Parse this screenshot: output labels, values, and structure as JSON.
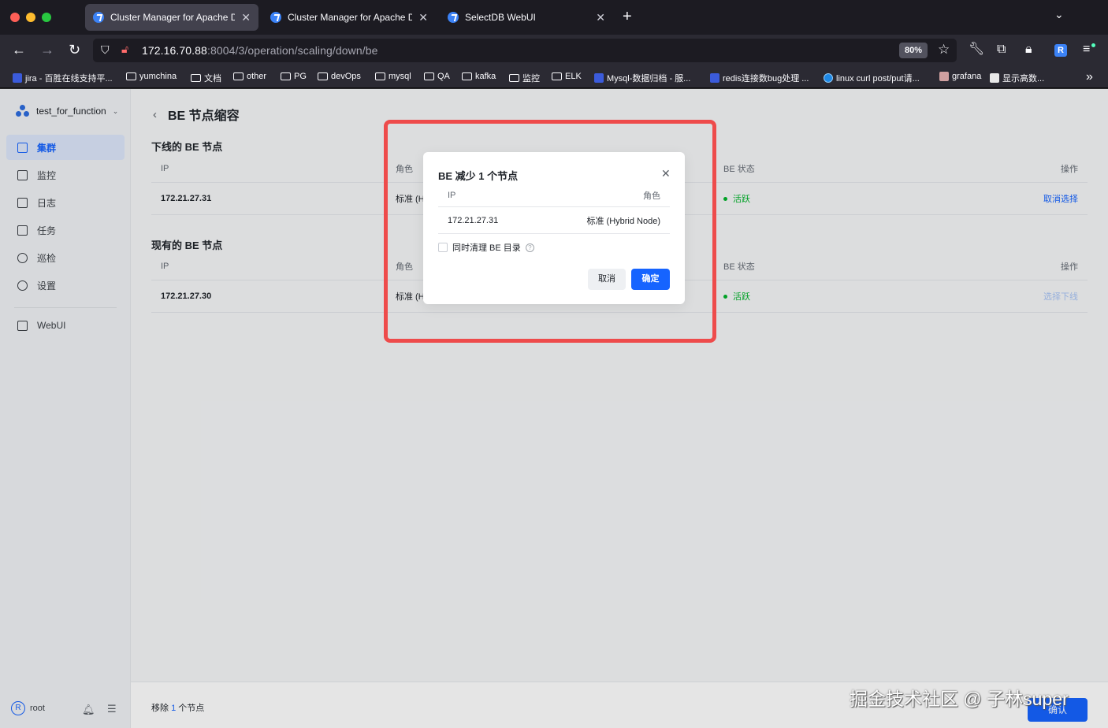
{
  "browser": {
    "tabs": [
      {
        "title": "Cluster Manager for Apache Doris",
        "active": true
      },
      {
        "title": "Cluster Manager for Apache Doris",
        "active": false
      },
      {
        "title": "SelectDB WebUI",
        "active": false
      }
    ],
    "url_host": "172.16.70.88",
    "url_rest": ":8004/3/operation/scaling/down/be",
    "zoom": "80%",
    "extension_label": "R",
    "bookmarks": [
      "jira - 百胜在线支持平...",
      "yumchina",
      "文档",
      "other",
      "PG",
      "devOps",
      "mysql",
      "QA",
      "kafka",
      "监控",
      "ELK",
      "Mysql-数据归档 - 服...",
      "redis连接数bug处理 ...",
      "linux curl post/put请...",
      "grafana",
      "显示高数..."
    ]
  },
  "sidebar": {
    "cluster_name": "test_for_function",
    "items": [
      {
        "label": "集群",
        "icon": "cluster-icon",
        "active": true
      },
      {
        "label": "监控",
        "icon": "monitor-icon",
        "active": false
      },
      {
        "label": "日志",
        "icon": "log-icon",
        "active": false
      },
      {
        "label": "任务",
        "icon": "task-icon",
        "active": false
      },
      {
        "label": "巡检",
        "icon": "inspection-icon",
        "active": false
      },
      {
        "label": "设置",
        "icon": "settings-icon",
        "active": false
      }
    ],
    "webui_label": "WebUI",
    "user": {
      "avatar": "R",
      "name": "root"
    }
  },
  "page": {
    "title": "BE 节点缩容",
    "offline_section": {
      "title": "下线的 BE 节点",
      "columns": {
        "ip": "IP",
        "role": "角色",
        "status": "BE 状态",
        "action": "操作"
      },
      "rows": [
        {
          "ip": "172.21.27.31",
          "role": "标准 (H",
          "status": "活跃",
          "action": "取消选择"
        }
      ]
    },
    "existing_section": {
      "title": "现有的 BE 节点",
      "columns": {
        "ip": "IP",
        "role": "角色",
        "status": "BE 状态",
        "action": "操作"
      },
      "rows": [
        {
          "ip": "172.21.27.30",
          "role": "标准 (H",
          "status": "活跃",
          "action": "选择下线"
        }
      ]
    },
    "footer": {
      "prefix": "移除",
      "count": "1",
      "suffix": "个节点",
      "confirm": "确认"
    }
  },
  "modal": {
    "title": "BE 减少 1 个节点",
    "columns": {
      "ip": "IP",
      "role": "角色"
    },
    "rows": [
      {
        "ip": "172.21.27.31",
        "role": "标准 (Hybrid Node)"
      }
    ],
    "checkbox_label": "同时清理 BE 目录",
    "cancel": "取消",
    "ok": "确定"
  },
  "colors": {
    "primary": "#1664ff",
    "success": "#00b42a",
    "highlight": "#ee4b4b"
  },
  "watermark": "掘金技术社区 @ 子林super"
}
